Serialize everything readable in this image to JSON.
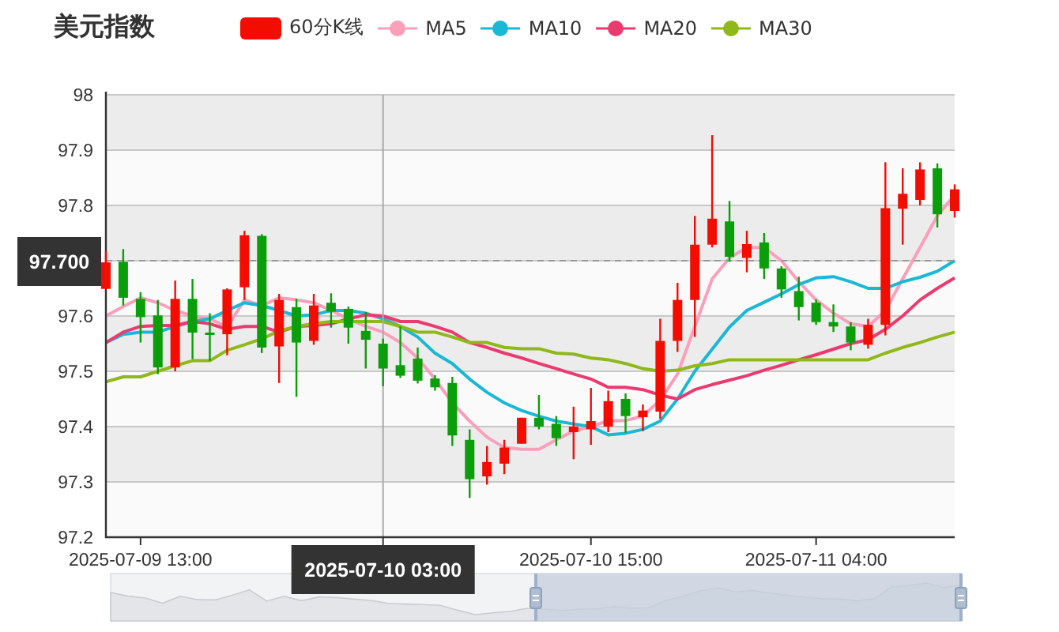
{
  "title": "美元指数",
  "legend": [
    {
      "label": "60分K线",
      "color": "#f20d00"
    }
  ],
  "chart": {
    "chart_data": {
      "type": "candlestick",
      "ylim": [
        97.2,
        98
      ],
      "grid": true,
      "yticks": [
        97.2,
        97.3,
        97.4,
        97.5,
        97.6,
        {
          "value": 97.7,
          "label": "97.700"
        },
        97.8,
        97.9,
        98
      ],
      "categories": [
        null,
        null,
        "2025-07-09 13:00",
        null,
        null,
        null,
        null,
        null,
        null,
        null,
        null,
        null,
        null,
        null,
        null,
        null,
        "2025-07-10 03:00",
        null,
        null,
        null,
        null,
        null,
        null,
        null,
        null,
        null,
        null,
        null,
        "2025-07-10 15:00",
        null,
        null,
        null,
        null,
        null,
        null,
        null,
        null,
        null,
        null,
        null,
        null,
        "2025-07-11 04:00",
        null,
        null,
        null,
        null,
        null,
        null,
        null,
        null
      ],
      "ohlc": [
        [
          97.649,
          97.717,
          97.649,
          97.697
        ],
        [
          97.698,
          97.721,
          97.619,
          97.633
        ],
        [
          97.631,
          97.643,
          97.552,
          97.598
        ],
        [
          97.601,
          97.629,
          97.495,
          97.507
        ],
        [
          97.507,
          97.664,
          97.5,
          97.631
        ],
        [
          97.631,
          97.667,
          97.522,
          97.57
        ],
        [
          97.57,
          97.605,
          97.519,
          97.566
        ],
        [
          97.567,
          97.65,
          97.529,
          97.648
        ],
        [
          97.652,
          97.754,
          97.629,
          97.746
        ],
        [
          97.745,
          97.748,
          97.533,
          97.543
        ],
        [
          97.545,
          97.64,
          97.479,
          97.629
        ],
        [
          97.616,
          97.631,
          97.454,
          97.552
        ],
        [
          97.555,
          97.64,
          97.548,
          97.619
        ],
        [
          97.624,
          97.641,
          97.579,
          97.608
        ],
        [
          97.613,
          97.617,
          97.55,
          97.579
        ],
        [
          97.573,
          97.607,
          97.505,
          97.557
        ],
        [
          97.55,
          97.559,
          97.473,
          97.505
        ],
        [
          97.511,
          97.581,
          97.488,
          97.492
        ],
        [
          97.523,
          97.543,
          97.478,
          97.483
        ],
        [
          97.487,
          97.493,
          97.465,
          97.471
        ],
        [
          97.479,
          97.49,
          97.365,
          97.384
        ],
        [
          97.376,
          97.395,
          97.271,
          97.305
        ],
        [
          97.31,
          97.365,
          97.295,
          97.336
        ],
        [
          97.333,
          97.376,
          97.314,
          97.362
        ],
        [
          97.369,
          97.416,
          97.369,
          97.416
        ],
        [
          97.416,
          97.457,
          97.395,
          97.4
        ],
        [
          97.405,
          97.419,
          97.365,
          97.379
        ],
        [
          97.39,
          97.436,
          97.341,
          97.4
        ],
        [
          97.395,
          97.47,
          97.367,
          97.41
        ],
        [
          97.4,
          97.465,
          97.39,
          97.446
        ],
        [
          97.45,
          97.46,
          97.389,
          97.419
        ],
        [
          97.417,
          97.44,
          97.392,
          97.429
        ],
        [
          97.427,
          97.595,
          97.414,
          97.555
        ],
        [
          97.555,
          97.66,
          97.535,
          97.629
        ],
        [
          97.629,
          97.781,
          97.562,
          97.729
        ],
        [
          97.729,
          97.927,
          97.724,
          97.776
        ],
        [
          97.771,
          97.808,
          97.698,
          97.707
        ],
        [
          97.705,
          97.754,
          97.679,
          97.73
        ],
        [
          97.733,
          97.75,
          97.667,
          97.686
        ],
        [
          97.686,
          97.69,
          97.633,
          97.648
        ],
        [
          97.645,
          97.671,
          97.592,
          97.616
        ],
        [
          97.624,
          97.63,
          97.584,
          97.589
        ],
        [
          97.589,
          97.621,
          97.571,
          97.581
        ],
        [
          97.581,
          97.589,
          97.538,
          97.552
        ],
        [
          97.548,
          97.595,
          97.541,
          97.584
        ],
        [
          97.584,
          97.878,
          97.565,
          97.795
        ],
        [
          97.794,
          97.867,
          97.729,
          97.821
        ],
        [
          97.81,
          97.878,
          97.8,
          97.865
        ],
        [
          97.867,
          97.876,
          97.76,
          97.784
        ],
        [
          97.79,
          97.838,
          97.778,
          97.829
        ]
      ],
      "series": [
        {
          "name": "MA5",
          "type": "line",
          "color": "#fb9fbb",
          "values": [
            97.6,
            97.617,
            97.633,
            97.624,
            97.61,
            97.6,
            97.595,
            97.58,
            97.629,
            97.619,
            97.633,
            97.629,
            97.624,
            97.61,
            97.595,
            97.581,
            97.571,
            97.552,
            97.524,
            97.486,
            97.443,
            97.41,
            97.381,
            97.362,
            97.359,
            97.359,
            97.376,
            97.392,
            97.4,
            97.411,
            97.411,
            97.419,
            97.448,
            97.495,
            97.581,
            97.667,
            97.705,
            97.724,
            97.724,
            97.7,
            97.662,
            97.629,
            97.605,
            97.586,
            97.581,
            97.61,
            97.667,
            97.724,
            97.781,
            97.819
          ]
        },
        {
          "name": "MA10",
          "type": "line",
          "color": "#1bb8d6",
          "values": [
            97.552,
            97.567,
            97.571,
            97.571,
            97.581,
            97.59,
            97.595,
            97.61,
            97.624,
            97.619,
            97.61,
            97.6,
            97.602,
            97.61,
            97.61,
            97.605,
            97.595,
            97.581,
            97.562,
            97.533,
            97.514,
            97.486,
            97.462,
            97.443,
            97.429,
            97.419,
            97.41,
            97.405,
            97.4,
            97.385,
            97.388,
            97.395,
            97.41,
            97.45,
            97.5,
            97.54,
            97.58,
            97.61,
            97.625,
            97.64,
            97.657,
            97.669,
            97.671,
            97.662,
            97.65,
            97.65,
            97.662,
            97.67,
            97.681,
            97.7
          ]
        },
        {
          "name": "MA20",
          "type": "line",
          "color": "#ea3a70",
          "values": [
            97.552,
            97.571,
            97.581,
            97.583,
            97.583,
            97.59,
            97.586,
            97.576,
            97.581,
            97.581,
            97.571,
            97.581,
            97.583,
            97.586,
            97.595,
            97.602,
            97.6,
            97.59,
            97.59,
            97.581,
            97.571,
            97.552,
            97.543,
            97.533,
            97.524,
            97.514,
            97.505,
            97.495,
            97.486,
            97.471,
            97.471,
            97.467,
            97.457,
            97.45,
            97.467,
            97.476,
            97.484,
            97.492,
            97.502,
            97.511,
            97.521,
            97.53,
            97.54,
            97.55,
            97.557,
            97.576,
            97.6,
            97.629,
            97.65,
            97.669
          ]
        },
        {
          "name": "MA30",
          "type": "line",
          "color": "#8fb81a",
          "values": [
            97.481,
            97.49,
            97.49,
            97.5,
            97.51,
            97.519,
            97.519,
            97.538,
            97.548,
            97.559,
            97.573,
            97.581,
            97.586,
            97.59,
            97.59,
            97.59,
            97.59,
            97.581,
            97.571,
            97.571,
            97.562,
            97.552,
            97.552,
            97.543,
            97.541,
            97.541,
            97.533,
            97.531,
            97.524,
            97.521,
            97.514,
            97.505,
            97.5,
            97.502,
            97.51,
            97.514,
            97.521,
            97.521,
            97.521,
            97.521,
            97.521,
            97.521,
            97.521,
            97.521,
            97.521,
            97.533,
            97.543,
            97.552,
            97.562,
            97.571
          ]
        }
      ],
      "ref_lines": [
        {
          "axis": "y",
          "value": 97.7
        },
        {
          "axis": "x",
          "value": "2025-07-10 03:00"
        }
      ]
    }
  },
  "data_zoom": {
    "level": 0.5
  }
}
